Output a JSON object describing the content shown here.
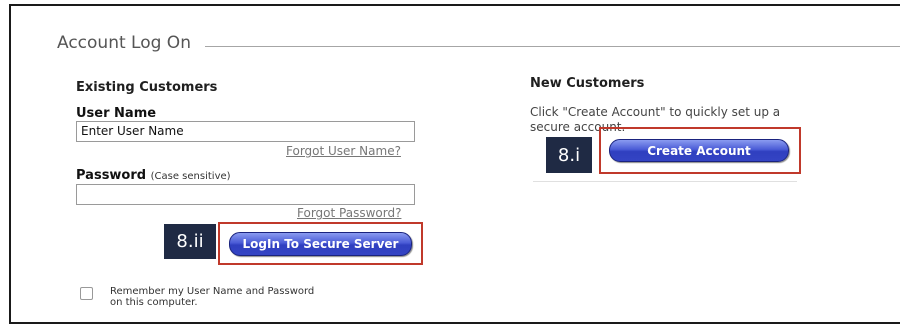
{
  "section": {
    "title": "Account Log On"
  },
  "existing": {
    "heading": "Existing Customers",
    "username_label": "User Name",
    "username_value": "Enter User Name",
    "forgot_username": "Forgot User Name?",
    "password_label": "Password",
    "password_hint": "(Case sensitive)",
    "password_value": "",
    "forgot_password": "Forgot Password?",
    "login_button": "LogIn To Secure Server",
    "remember_line1": "Remember my User Name and Password",
    "remember_line2": "on this computer.",
    "remember_checked": false
  },
  "new_customers": {
    "heading": "New Customers",
    "desc_line1": "Click \"Create Account\" to quickly set up a",
    "desc_line2": "secure account.",
    "create_button": "Create Account"
  },
  "callouts": {
    "create": "8.i",
    "login": "8.ii",
    "highlight_color": "#c0392b",
    "badge_color": "#1f2a44"
  },
  "colors": {
    "button_blue": "#3a4bd0",
    "link_gray": "#777777"
  }
}
